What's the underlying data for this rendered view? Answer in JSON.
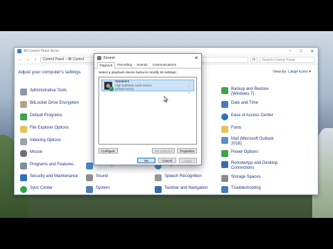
{
  "control_panel": {
    "title": "All Control Panel Items",
    "breadcrumb": [
      "Control Panel",
      "All Control"
    ],
    "search_placeholder": "Search Control Panel",
    "heading": "Adjust your computer's settings",
    "view_by_label": "View by:",
    "view_by_value": "Large icons",
    "col1": [
      "Administrative Tools",
      "BitLocker Drive Encryption",
      "Default Programs",
      "File Explorer Options",
      "Indexing Options",
      "Mouse",
      "Programs and Features",
      "Security and Maintenance",
      "Sync Center"
    ],
    "col2": [
      "Recovery",
      "Sound",
      "System"
    ],
    "col3": [
      "Region",
      "Speech Recognition",
      "Taskbar and Navigation"
    ],
    "col4": [
      "Backup and Restore (Windows 7)",
      "Date and Time",
      "Ease of Access Center",
      "Fonts",
      "Mail (Microsoft Outlook 2016)",
      "Power Options",
      "RemoteApp and Desktop Connections",
      "Storage Spaces",
      "Troubleshooting"
    ]
  },
  "sound_dialog": {
    "title": "Sound",
    "tabs": [
      "Playback",
      "Recording",
      "Sounds",
      "Communications"
    ],
    "prompt": "Select a playback device below to modify its settings:",
    "device_name": "Speakers",
    "device_desc": "High Definition Audio Device",
    "device_status": "Default Device",
    "configure": "Configure",
    "set_default": "Set Default",
    "properties": "Properties",
    "ok": "OK",
    "cancel": "Cancel",
    "apply": "Apply"
  },
  "colors": {
    "link": "#1e3287",
    "selection": "#cde3f8",
    "accent": "#0078d7"
  }
}
